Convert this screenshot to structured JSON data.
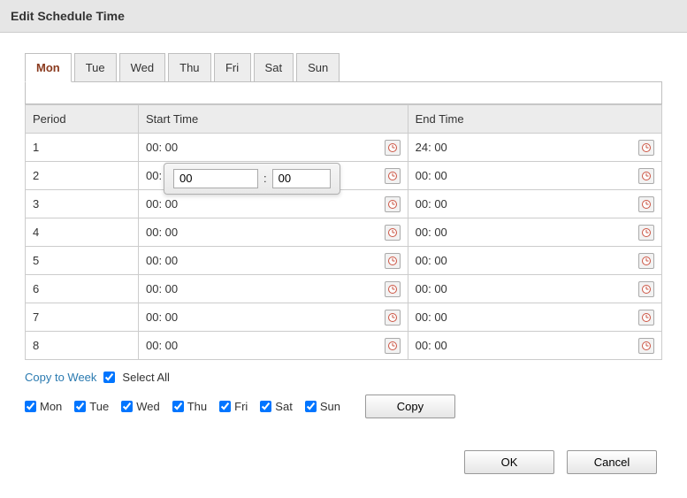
{
  "title": "Edit Schedule Time",
  "tabs": [
    "Mon",
    "Tue",
    "Wed",
    "Thu",
    "Fri",
    "Sat",
    "Sun"
  ],
  "active_tab": 0,
  "table": {
    "headers": {
      "period": "Period",
      "start": "Start Time",
      "end": "End Time"
    },
    "rows": [
      {
        "period": "1",
        "start": "00: 00",
        "end": "24: 00"
      },
      {
        "period": "2",
        "start": "00: 00",
        "end": "00: 00"
      },
      {
        "period": "3",
        "start": "00: 00",
        "end": "00: 00"
      },
      {
        "period": "4",
        "start": "00: 00",
        "end": "00: 00"
      },
      {
        "period": "5",
        "start": "00: 00",
        "end": "00: 00"
      },
      {
        "period": "6",
        "start": "00: 00",
        "end": "00: 00"
      },
      {
        "period": "7",
        "start": "00: 00",
        "end": "00: 00"
      },
      {
        "period": "8",
        "start": "00: 00",
        "end": "00: 00"
      }
    ]
  },
  "time_popup": {
    "row": 1,
    "hour": "00",
    "minute": "00",
    "sep": ":"
  },
  "copy": {
    "link": "Copy to Week",
    "select_all": "Select All",
    "select_all_checked": true,
    "days": [
      {
        "label": "Mon",
        "checked": true
      },
      {
        "label": "Tue",
        "checked": true
      },
      {
        "label": "Wed",
        "checked": true
      },
      {
        "label": "Thu",
        "checked": true
      },
      {
        "label": "Fri",
        "checked": true
      },
      {
        "label": "Sat",
        "checked": true
      },
      {
        "label": "Sun",
        "checked": true
      }
    ],
    "copy_btn": "Copy"
  },
  "footer": {
    "ok": "OK",
    "cancel": "Cancel"
  }
}
